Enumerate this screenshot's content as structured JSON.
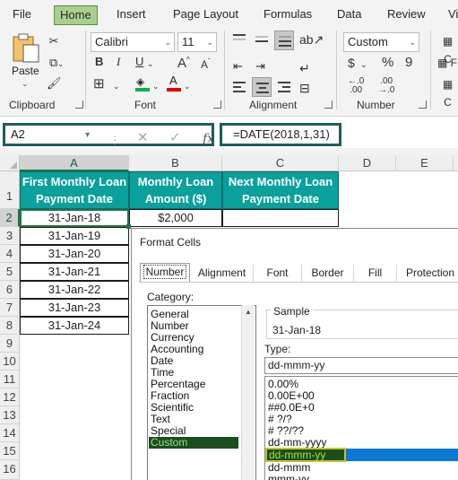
{
  "ribbon": {
    "tabs": [
      "File",
      "Home",
      "Insert",
      "Page Layout",
      "Formulas",
      "Data",
      "Review",
      "Vi"
    ],
    "active_tab": "Home",
    "clipboard": {
      "paste_label": "Paste",
      "group_label": "Clipboard"
    },
    "font": {
      "name": "Calibri",
      "size": "11",
      "bold": "B",
      "italic": "I",
      "underline": "U",
      "group_label": "Font"
    },
    "alignment": {
      "group_label": "Alignment"
    },
    "number": {
      "format": "Custom",
      "group_label": "Number",
      "currency_symbol": "$",
      "percent_symbol": "%",
      "comma_symbol": "9"
    }
  },
  "formula_bar": {
    "name_box": "A2",
    "formula": "=DATE(2018,1,31)"
  },
  "sheet": {
    "columns": [
      "A",
      "B",
      "C",
      "D",
      "E"
    ],
    "rows": [
      "1",
      "2",
      "3",
      "4",
      "5",
      "6",
      "7",
      "8",
      "9",
      "10",
      "11",
      "12",
      "13",
      "14",
      "15",
      "16"
    ],
    "headers": {
      "a": "First Monthly Loan Payment Date",
      "b": "Monthly Loan Amount ($)",
      "c": "Next Monthly Loan Payment Date"
    },
    "col_a": [
      "31-Jan-18",
      "31-Jan-19",
      "31-Jan-20",
      "31-Jan-21",
      "31-Jan-22",
      "31-Jan-23",
      "31-Jan-24"
    ],
    "b2": "$2,000"
  },
  "dialog": {
    "title": "Format Cells",
    "tabs": [
      "Number",
      "Alignment",
      "Font",
      "Border",
      "Fill",
      "Protection"
    ],
    "category_label": "Category:",
    "categories": [
      "General",
      "Number",
      "Currency",
      "Accounting",
      "Date",
      "Time",
      "Percentage",
      "Fraction",
      "Scientific",
      "Text",
      "Special",
      "Custom"
    ],
    "selected_category": "Custom",
    "sample_label": "Sample",
    "sample_value": "31-Jan-18",
    "type_label": "Type:",
    "type_value": "dd-mmm-yy",
    "types": [
      "0.00%",
      "0.00E+00",
      "##0.0E+0",
      "# ?/?",
      "# ??/??",
      "dd-mm-yyyy",
      "dd-mmm-yy",
      "dd-mmm",
      "mmm-yy"
    ],
    "selected_type": "dd-mmm-yy"
  },
  "colors": {
    "header_teal": "#0aa09c",
    "excel_green": "#217346",
    "highlight_blue": "#0a78d4"
  }
}
